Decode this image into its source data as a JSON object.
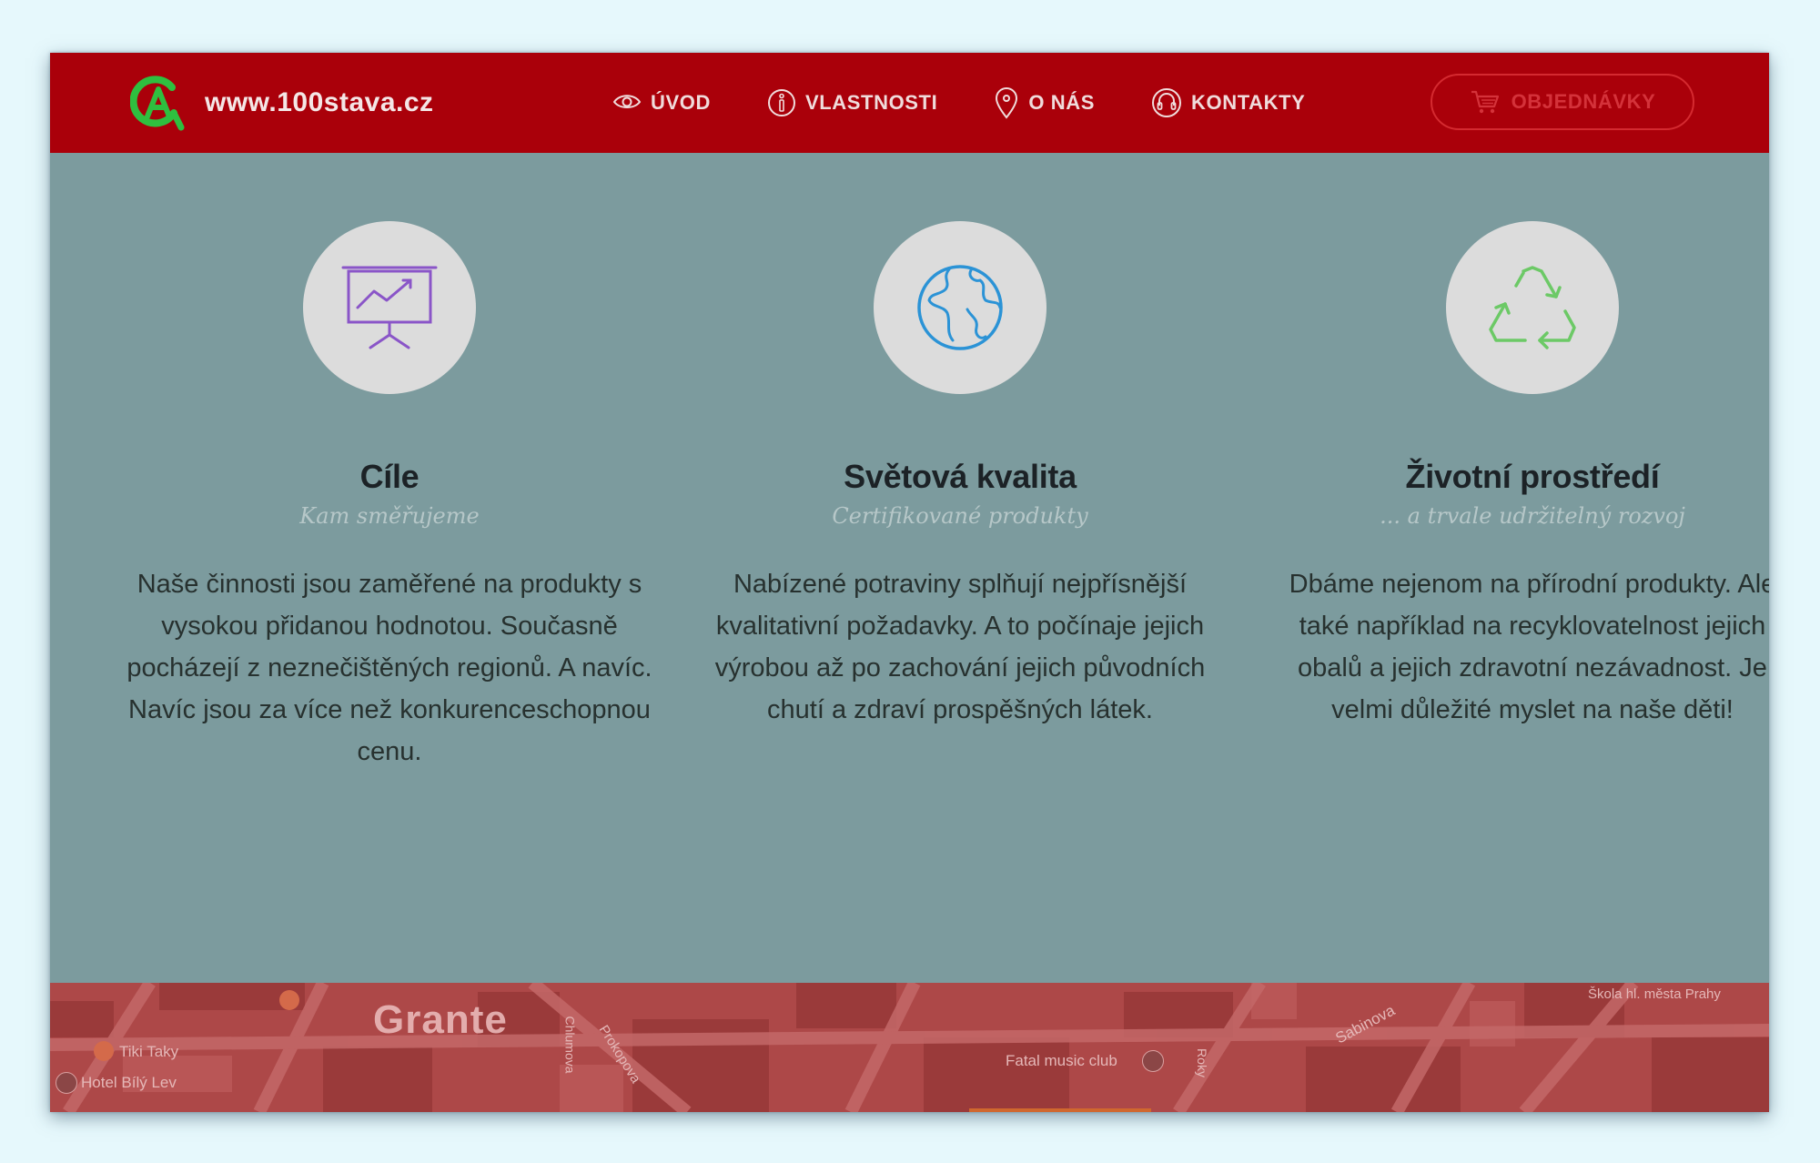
{
  "brand": {
    "text": "www.100stava.cz",
    "logo_color": "#2fbf3f"
  },
  "nav": {
    "items": [
      {
        "label": "ÚVOD",
        "icon": "eye-icon"
      },
      {
        "label": "VLASTNOSTI",
        "icon": "info-icon"
      },
      {
        "label": "O NÁS",
        "icon": "map-pin-icon"
      },
      {
        "label": "KONTAKTY",
        "icon": "headset-icon"
      }
    ],
    "order_button": {
      "label": "OBJEDNÁVKY",
      "icon": "cart-icon"
    }
  },
  "features": [
    {
      "icon": "presentation-chart-icon",
      "title": "Cíle",
      "subtitle": "Kam směřujeme",
      "text": "Naše činnosti jsou zaměřené na produkty s vysokou přidanou hodnotou. Současně pocházejí z neznečištěných regionů. A navíc. Navíc jsou za více než konkurenceschopnou cenu."
    },
    {
      "icon": "globe-icon",
      "title": "Světová kvalita",
      "subtitle": "Certifikované produkty",
      "text": "Nabízené potraviny splňují nejpřísnější kvalitativní požadavky. A to počínaje jejich výrobou až po zachování jejich původních chutí a zdraví prospěšných látek."
    },
    {
      "icon": "recycle-icon",
      "title": "Životní prostředí",
      "subtitle": "... a trvale udržitelný rozvoj",
      "text": "Dbáme nejenom na přírodní produkty. Ale také například na recyklovatelnost jejich obalů a jejich zdravotní nezávadnost. Je velmi důležité myslet na naše děti!"
    }
  ],
  "map": {
    "district": "Grante",
    "labels": {
      "tiki": "Tiki Taky",
      "hotel": "Hotel Bílý Lev",
      "prokopova": "Prokopova",
      "fatal": "Fatal music club",
      "sabinova": "Sabinova",
      "school": "Škola hl. města Prahy",
      "chlumova": "Chlumova",
      "rokycanova": "Roky"
    }
  },
  "colors": {
    "navbar": "#aa000a",
    "content_bg": "#7c9b9e",
    "icon_purple": "#8a55c8",
    "icon_blue": "#2b93d6",
    "icon_green": "#6cc966",
    "map_red": "#ad4848"
  }
}
